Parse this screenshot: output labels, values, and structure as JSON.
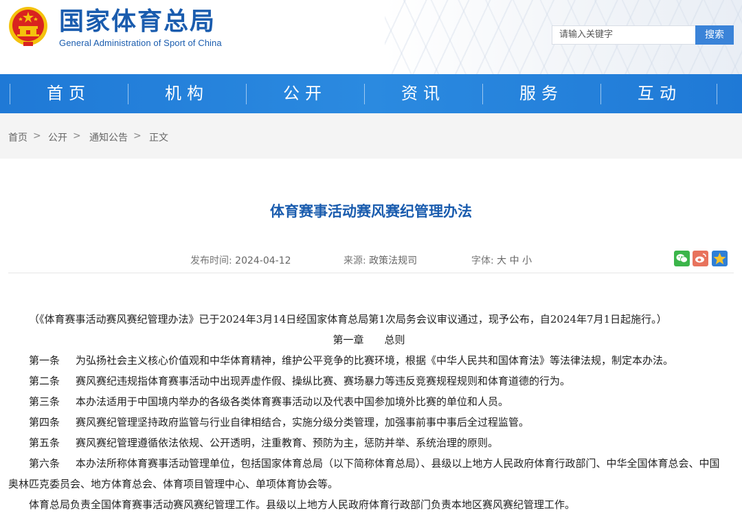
{
  "header": {
    "title_cn": "国家体育总局",
    "title_en": "General Administration of Sport of China",
    "search_placeholder": "请输入关键字",
    "search_button": "搜索"
  },
  "nav": [
    "首页",
    "机构",
    "公开",
    "资讯",
    "服务",
    "互动"
  ],
  "breadcrumb": {
    "items": [
      "首页",
      "公开",
      "通知公告",
      "正文"
    ],
    "separator": ">"
  },
  "article": {
    "title": "体育赛事活动赛风赛纪管理办法",
    "date_label": "发布时间:",
    "date": "2024-04-12",
    "source_label": "来源:",
    "source": "政策法规司",
    "font_label": "字体:",
    "font_sizes": [
      "大",
      "中",
      "小"
    ],
    "intro": "（《体育赛事活动赛风赛纪管理办法》已于2024年3月14日经国家体育总局第1次局务会议审议通过，现予公布，自2024年7月1日起施行。）",
    "chapter": "第一章　　总则",
    "articles": [
      {
        "name": "第一条",
        "text": "为弘扬社会主义核心价值观和中华体育精神，维护公平竞争的比赛环境，根据《中华人民共和国体育法》等法律法规，制定本办法。"
      },
      {
        "name": "第二条",
        "text": "赛风赛纪违规指体育赛事活动中出现弄虚作假、操纵比赛、赛场暴力等违反竞赛规程规则和体育道德的行为。"
      },
      {
        "name": "第三条",
        "text": "本办法适用于中国境内举办的各级各类体育赛事活动以及代表中国参加境外比赛的单位和人员。"
      },
      {
        "name": "第四条",
        "text": "赛风赛纪管理坚持政府监管与行业自律相结合，实施分级分类管理，加强事前事中事后全过程监管。"
      },
      {
        "name": "第五条",
        "text": "赛风赛纪管理遵循依法依规、公开透明，注重教育、预防为主，惩防并举、系统治理的原则。"
      },
      {
        "name": "第六条",
        "text": "本办法所称体育赛事活动管理单位，包括国家体育总局（以下简称体育总局）、县级以上地方人民政府体育行政部门、中华全国体育总会、中国奥林匹克委员会、地方体育总会、体育项目管理中心、单项体育协会等。"
      }
    ],
    "last_paragraph": "体育总局负责全国体育赛事活动赛风赛纪管理工作。县级以上地方人民政府体育行政部门负责本地区赛风赛纪管理工作。"
  },
  "colors": {
    "brand_blue": "#1a5cae",
    "nav_blue": "#2b8ae0",
    "search_button": "#3a83d8",
    "emblem_red": "#d9231f",
    "emblem_gold": "#f4c20d"
  },
  "icons": [
    "national-emblem",
    "wechat-icon",
    "weibo-icon",
    "favorite-icon"
  ]
}
